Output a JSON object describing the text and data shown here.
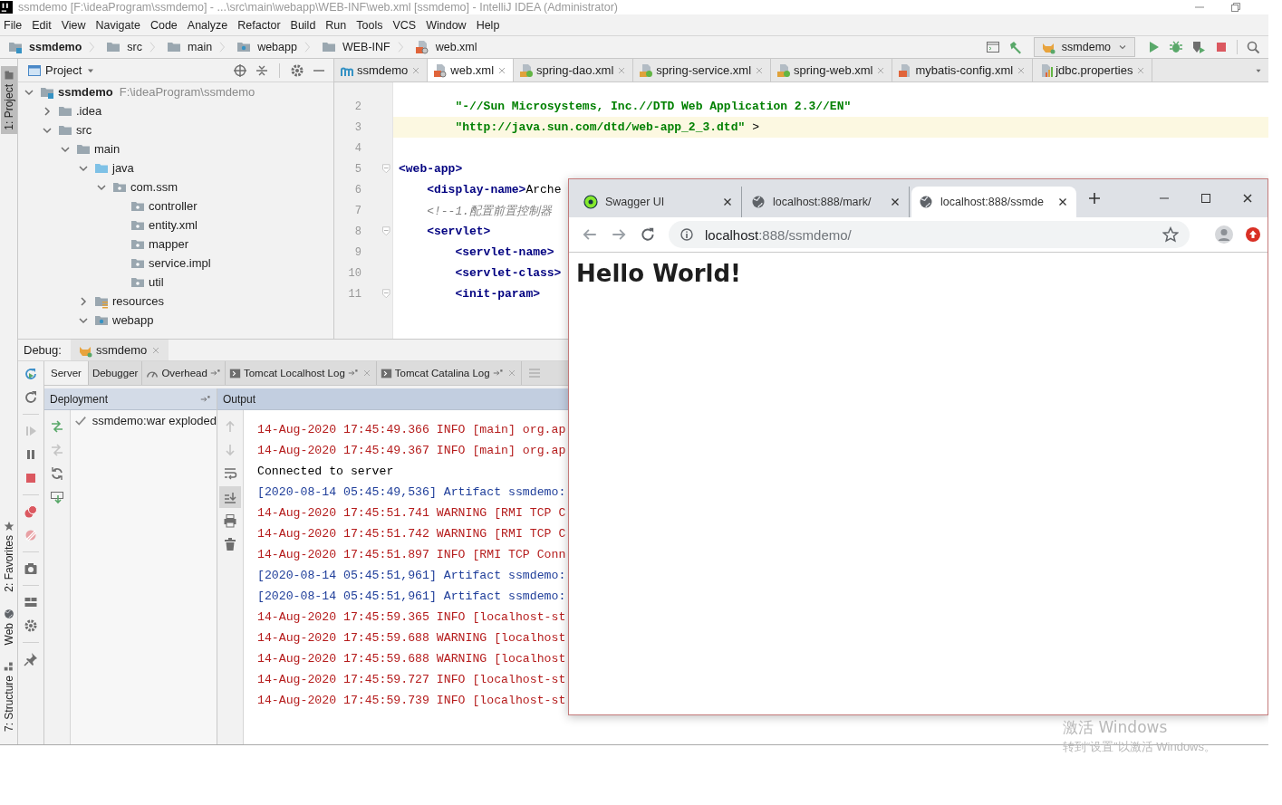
{
  "title_bar": {
    "title": "ssmdemo [F:\\ideaProgram\\ssmdemo] - ...\\src\\main\\webapp\\WEB-INF\\web.xml [ssmdemo] - IntelliJ IDEA (Administrator)"
  },
  "menu": [
    "File",
    "Edit",
    "View",
    "Navigate",
    "Code",
    "Analyze",
    "Refactor",
    "Build",
    "Run",
    "Tools",
    "VCS",
    "Window",
    "Help"
  ],
  "breadcrumb": [
    {
      "label": "ssmdemo",
      "kind": "module"
    },
    {
      "label": "src",
      "kind": "folder"
    },
    {
      "label": "main",
      "kind": "folder"
    },
    {
      "label": "webapp",
      "kind": "webapp"
    },
    {
      "label": "WEB-INF",
      "kind": "folder"
    },
    {
      "label": "web.xml",
      "kind": "xml"
    }
  ],
  "run_config": {
    "label": "ssmdemo"
  },
  "tool_stripe": [
    {
      "label": "1: Project",
      "kind": "project",
      "selected": true
    },
    {
      "label": "2: Favorites",
      "kind": "favorites",
      "selected": false
    },
    {
      "label": "Web",
      "kind": "web",
      "selected": false
    },
    {
      "label": "7: Structure",
      "kind": "structure",
      "selected": false
    }
  ],
  "project": {
    "title": "Project",
    "tree": [
      {
        "label": "ssmdemo",
        "kind": "module",
        "path": "F:\\ideaProgram\\ssmdemo",
        "expanded": true,
        "children": [
          {
            "label": ".idea",
            "kind": "folder",
            "expanded": false
          },
          {
            "label": "src",
            "kind": "folder",
            "expanded": true,
            "children": [
              {
                "label": "main",
                "kind": "folder",
                "expanded": true,
                "children": [
                  {
                    "label": "java",
                    "kind": "source",
                    "expanded": true,
                    "children": [
                      {
                        "label": "com.ssm",
                        "kind": "package",
                        "expanded": true,
                        "children": [
                          {
                            "label": "controller",
                            "kind": "package"
                          },
                          {
                            "label": "entity.xml",
                            "kind": "package"
                          },
                          {
                            "label": "mapper",
                            "kind": "package"
                          },
                          {
                            "label": "service.impl",
                            "kind": "package"
                          },
                          {
                            "label": "util",
                            "kind": "package"
                          }
                        ]
                      }
                    ]
                  },
                  {
                    "label": "resources",
                    "kind": "resources",
                    "expanded": false
                  },
                  {
                    "label": "webapp",
                    "kind": "webapp",
                    "expanded": true
                  }
                ]
              }
            ]
          }
        ]
      }
    ]
  },
  "editor": {
    "tabs": [
      {
        "label": "ssmdemo",
        "kind": "maven",
        "selected": false
      },
      {
        "label": "web.xml",
        "kind": "xml",
        "selected": true
      },
      {
        "label": "spring-dao.xml",
        "kind": "spring",
        "selected": false
      },
      {
        "label": "spring-service.xml",
        "kind": "spring",
        "selected": false
      },
      {
        "label": "spring-web.xml",
        "kind": "spring",
        "selected": false
      },
      {
        "label": "mybatis-config.xml",
        "kind": "mybatis",
        "selected": false
      },
      {
        "label": "jdbc.properties",
        "kind": "properties",
        "selected": false
      }
    ],
    "lines": [
      {
        "number": "2",
        "kind": "continuation",
        "current": false,
        "fold": false,
        "tokens": [
          {
            "kind": "string",
            "text": "\"-//Sun Microsystems, Inc.//DTD Web Application 2.3//EN\""
          }
        ]
      },
      {
        "number": "3",
        "kind": "continuation",
        "current": true,
        "fold": false,
        "tokens": [
          {
            "kind": "string",
            "text": "\"http://java.sun.com/dtd/web-app_2_3.dtd\""
          },
          {
            "kind": "text",
            "text": ">"
          }
        ]
      },
      {
        "number": "4",
        "kind": "line",
        "current": false,
        "fold": false
      },
      {
        "number": "5",
        "kind": "line",
        "current": false,
        "fold": true,
        "tokens": [
          {
            "kind": "tag",
            "text": "<web-app>"
          }
        ],
        "children": [
          {
            "number": "6",
            "kind": "line",
            "current": false,
            "fold": false,
            "tokens": [
              {
                "kind": "tag",
                "text": "<display-name>"
              },
              {
                "kind": "text",
                "text": "Arche"
              }
            ]
          },
          {
            "number": "7",
            "kind": "line",
            "current": false,
            "fold": false,
            "tokens": [
              {
                "kind": "comment",
                "text": "<!--1.配置前置控制器"
              }
            ]
          },
          {
            "number": "8",
            "kind": "line",
            "current": false,
            "fold": true,
            "tokens": [
              {
                "kind": "tag",
                "text": "<servlet>"
              }
            ],
            "children": [
              {
                "number": "9",
                "kind": "line",
                "current": false,
                "fold": false,
                "tokens": [
                  {
                    "kind": "tag",
                    "text": "<servlet-name>"
                  }
                ]
              },
              {
                "number": "10",
                "kind": "line",
                "current": false,
                "fold": false,
                "tokens": [
                  {
                    "kind": "tag",
                    "text": "<servlet-class>"
                  }
                ]
              },
              {
                "number": "11",
                "kind": "line",
                "current": false,
                "fold": true,
                "tokens": [
                  {
                    "kind": "tag",
                    "text": "<init-param>"
                  }
                ]
              }
            ]
          }
        ]
      }
    ]
  },
  "debug": {
    "label": "Debug:",
    "session": "ssmdemo",
    "tabs": [
      {
        "label": "Server",
        "kind": "plain",
        "selected": true
      },
      {
        "label": "Debugger",
        "kind": "plain",
        "selected": false
      },
      {
        "label": "Overhead",
        "kind": "overhead",
        "selected": false
      },
      {
        "label": "Tomcat Localhost Log",
        "kind": "log",
        "selected": false
      },
      {
        "label": "Tomcat Catalina Log",
        "kind": "log",
        "selected": false
      }
    ],
    "deployment": {
      "title": "Deployment",
      "items": [
        {
          "label": "ssmdemo:war exploded",
          "deployed": true
        }
      ]
    },
    "output": {
      "title": "Output",
      "lines": [
        {
          "kind": "stderr",
          "text": "14-Aug-2020 17:45:49.366 INFO [main] org.ap"
        },
        {
          "kind": "stderr",
          "text": "14-Aug-2020 17:45:49.367 INFO [main] org.ap"
        },
        {
          "kind": "stdout",
          "text": "Connected to server"
        },
        {
          "kind": "system",
          "text": "[2020-08-14 05:45:49,536] Artifact ssmdemo:"
        },
        {
          "kind": "stderr",
          "text": "14-Aug-2020 17:45:51.741 WARNING [RMI TCP C"
        },
        {
          "kind": "stderr",
          "text": "14-Aug-2020 17:45:51.742 WARNING [RMI TCP C"
        },
        {
          "kind": "stderr",
          "text": "14-Aug-2020 17:45:51.897 INFO [RMI TCP Conn"
        },
        {
          "kind": "system",
          "text": "[2020-08-14 05:45:51,961] Artifact ssmdemo:"
        },
        {
          "kind": "system",
          "text": "[2020-08-14 05:45:51,961] Artifact ssmdemo:"
        },
        {
          "kind": "stderr",
          "text": "14-Aug-2020 17:45:59.365 INFO [localhost-st"
        },
        {
          "kind": "stderr",
          "text": "14-Aug-2020 17:45:59.688 WARNING [localhost"
        },
        {
          "kind": "stderr",
          "text": "14-Aug-2020 17:45:59.688 WARNING [localhost"
        },
        {
          "kind": "stderr",
          "text": "14-Aug-2020 17:45:59.727 INFO [localhost-st"
        },
        {
          "kind": "stderr",
          "text": "14-Aug-2020 17:45:59.739 INFO [localhost-st"
        }
      ]
    }
  },
  "browser": {
    "tabs": [
      {
        "title": "Swagger UI",
        "kind": "swagger",
        "selected": false
      },
      {
        "title": "localhost:888/mark/",
        "kind": "globe",
        "selected": false
      },
      {
        "title": "localhost:888/ssmde",
        "kind": "globe",
        "selected": true
      }
    ],
    "address": {
      "host": "localhost",
      "path": ":888/ssmdemo/"
    },
    "heading": "Hello World!"
  },
  "os_notice": {
    "title": "激活 Windows",
    "text": "转到“设置”以激活 Windows。"
  }
}
